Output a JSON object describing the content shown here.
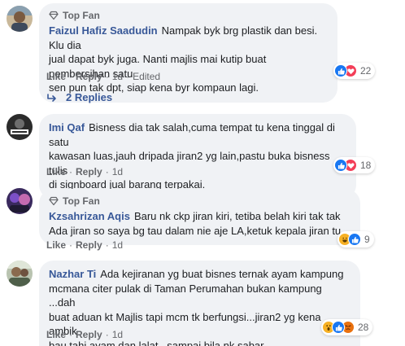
{
  "comments": [
    {
      "badge": "Top Fan",
      "name": "Faizul Hafiz Saadudin",
      "text_lines": [
        "Nampak byk brg plastik dan besi. Klu dia",
        "jual dapat byk juga. Nanti majlis mai kutip buat pembersihan satu",
        "sen pun tak dpt, siap kena byr kompaun lagi."
      ],
      "actions": {
        "like": "Like",
        "reply": "Reply",
        "time": "1d",
        "edited": "Edited"
      },
      "reaction_count": "22",
      "reactions": [
        "like",
        "love"
      ]
    },
    {
      "badge": "",
      "name": "Imi Qaf",
      "text_lines": [
        "Bisness dia tak salah,cuma tempat tu kena tinggal di satu",
        "kawasan luas,jauh dripada jiran2 yg lain,pastu buka bisness tulis",
        "di signboard jual barang terpakai."
      ],
      "actions": {
        "like": "Like",
        "reply": "Reply",
        "time": "1d"
      },
      "reaction_count": "18",
      "reactions": [
        "like",
        "love"
      ]
    },
    {
      "badge": "Top Fan",
      "name": "Kzsahrizan Aqis",
      "text_lines": [
        "Baru nk ckp jiran kiri, tetiba belah kiri tak tak",
        "Ada jiran so saya bg tau dalam nie aje LA,ketuk kepala jiran tu"
      ],
      "actions": {
        "like": "Like",
        "reply": "Reply",
        "time": "1d"
      },
      "reaction_count": "9",
      "reactions": [
        "haha",
        "like"
      ]
    },
    {
      "badge": "",
      "name": "Nazhar Ti",
      "text_lines": [
        "Ada kejiranan yg buat bisnes ternak ayam kampung",
        "mcmana citer pulak di Taman Perumahan bukan kampung ...dah",
        "buat aduan kt Majlis tapi mcm tk berfungsi...jiran2 yg kena ambik",
        "bau tahi ayam dan lalat...sampai bila nk sabar"
      ],
      "actions": {
        "like": "Like",
        "reply": "Reply",
        "time": "1d"
      },
      "reaction_count": "28",
      "reactions": [
        "wow",
        "like",
        "angry"
      ]
    }
  ],
  "replies_label": "2 Replies",
  "separator": "·",
  "colors": {
    "name": "#385898",
    "bubble": "#f0f2f5",
    "meta": "#65676b",
    "like": "#1877f2",
    "love": "#f33e58"
  }
}
